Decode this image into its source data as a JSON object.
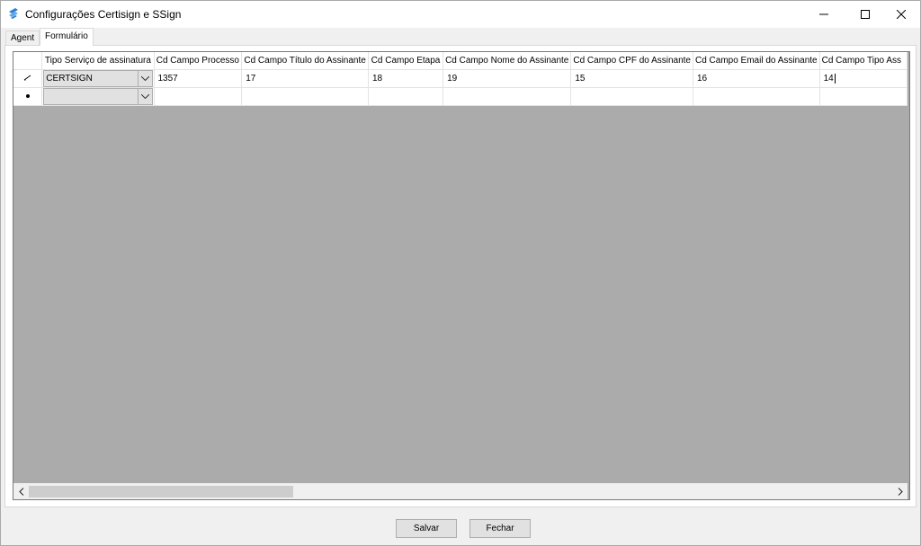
{
  "window": {
    "title": "Configurações Certisign e SSign"
  },
  "tabs": [
    {
      "label": "Agent",
      "active": false
    },
    {
      "label": "Formulário",
      "active": true
    }
  ],
  "grid": {
    "columns": [
      "Tipo Serviço de assinatura",
      "Cd Campo Processo",
      "Cd Campo Título do Assinante",
      "Cd Campo Etapa",
      "Cd Campo Nome do Assinante",
      "Cd Campo CPF do Assinante",
      "Cd Campo Email do Assinante",
      "Cd Campo Tipo Ass"
    ],
    "rows": [
      {
        "indicator": "edit-pencil-icon",
        "tipo": "CERTSIGN",
        "processo": "1357",
        "titulo": "17",
        "etapa": "18",
        "nome": "19",
        "cpf": "15",
        "email": "16",
        "tipo_ass": "14"
      },
      {
        "indicator": "new-row-icon",
        "tipo": "",
        "processo": "",
        "titulo": "",
        "etapa": "",
        "nome": "",
        "cpf": "",
        "email": "",
        "tipo_ass": ""
      }
    ]
  },
  "buttons": {
    "save_label": "Salvar",
    "close_label": "Fechar"
  },
  "colors": {
    "grid_background": "#ababab",
    "app_icon": "#2f7fd6"
  }
}
